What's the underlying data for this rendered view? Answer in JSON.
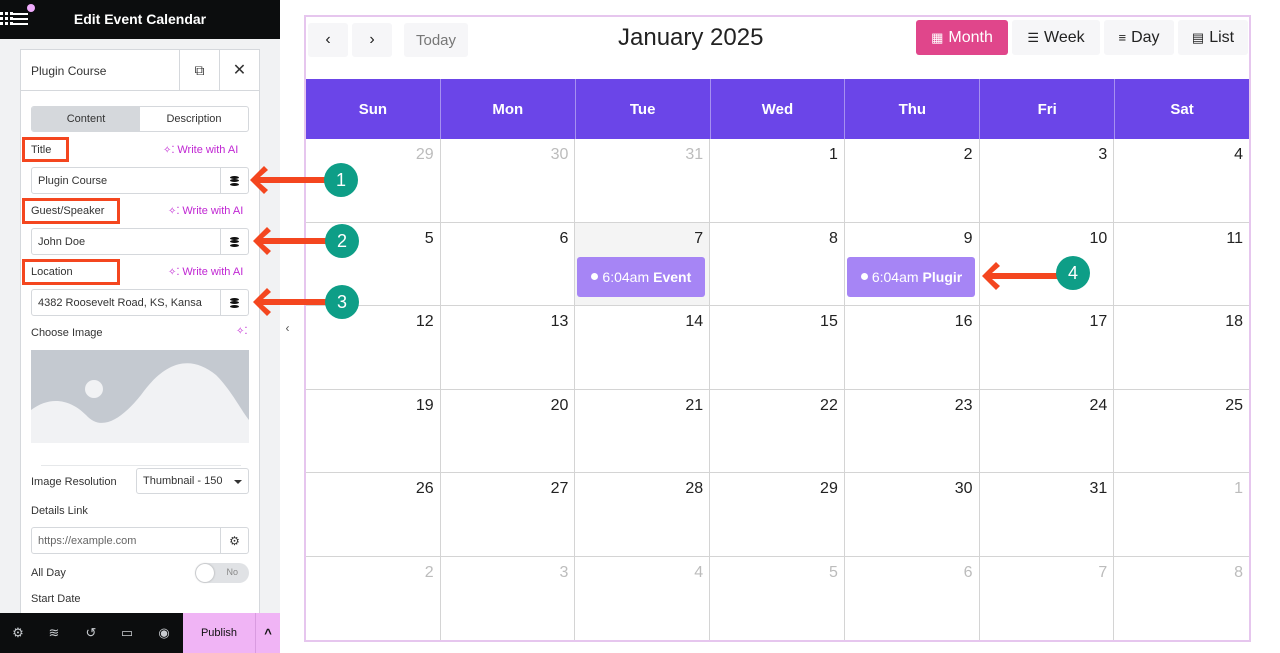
{
  "editor": {
    "title": "Edit Event Calendar",
    "widget_name": "Plugin Course",
    "tabs": [
      {
        "label": "Content",
        "active": true
      },
      {
        "label": "Description",
        "active": false
      }
    ],
    "write_ai_label": "Write with AI",
    "fields": {
      "title": {
        "label": "Title",
        "value": "Plugin Course"
      },
      "guest": {
        "label": "Guest/Speaker",
        "value": "John Doe"
      },
      "location": {
        "label": "Location",
        "value": "4382 Roosevelt Road, KS, Kansa"
      }
    },
    "choose_image_label": "Choose Image",
    "image_resolution": {
      "label": "Image Resolution",
      "value": "Thumbnail - 150"
    },
    "details_link": {
      "label": "Details Link",
      "placeholder": "https://example.com"
    },
    "all_day": {
      "label": "All Day",
      "value": "No"
    },
    "start_date_label": "Start Date",
    "publish_label": "Publish",
    "bottom_icons": [
      "gear-icon",
      "layers-icon",
      "history-icon",
      "responsive-icon",
      "eye-icon"
    ]
  },
  "calendar": {
    "title": "January 2025",
    "today_label": "Today",
    "prev_icon": "‹",
    "next_icon": "›",
    "views": [
      {
        "label": "Month",
        "icon": "grid-icon",
        "active": true
      },
      {
        "label": "Week",
        "icon": "list-icon",
        "active": false
      },
      {
        "label": "Day",
        "icon": "bars-icon",
        "active": false
      },
      {
        "label": "List",
        "icon": "list-block-icon",
        "active": false
      }
    ],
    "weekdays": [
      "Sun",
      "Mon",
      "Tue",
      "Wed",
      "Thu",
      "Fri",
      "Sat"
    ],
    "weeks": [
      [
        {
          "d": "29",
          "o": true
        },
        {
          "d": "30",
          "o": true
        },
        {
          "d": "31",
          "o": true
        },
        {
          "d": "1"
        },
        {
          "d": "2"
        },
        {
          "d": "3"
        },
        {
          "d": "4"
        }
      ],
      [
        {
          "d": "5"
        },
        {
          "d": "6"
        },
        {
          "d": "7",
          "today": true
        },
        {
          "d": "8"
        },
        {
          "d": "9"
        },
        {
          "d": "10"
        },
        {
          "d": "11"
        }
      ],
      [
        {
          "d": "12"
        },
        {
          "d": "13"
        },
        {
          "d": "14"
        },
        {
          "d": "15"
        },
        {
          "d": "16"
        },
        {
          "d": "17"
        },
        {
          "d": "18"
        }
      ],
      [
        {
          "d": "19"
        },
        {
          "d": "20"
        },
        {
          "d": "21"
        },
        {
          "d": "22"
        },
        {
          "d": "23"
        },
        {
          "d": "24"
        },
        {
          "d": "25"
        }
      ],
      [
        {
          "d": "26"
        },
        {
          "d": "27"
        },
        {
          "d": "28"
        },
        {
          "d": "29"
        },
        {
          "d": "30"
        },
        {
          "d": "31"
        },
        {
          "d": "1",
          "o": true
        }
      ],
      [
        {
          "d": "2",
          "o": true
        },
        {
          "d": "3",
          "o": true
        },
        {
          "d": "4",
          "o": true
        },
        {
          "d": "5",
          "o": true
        },
        {
          "d": "6",
          "o": true
        },
        {
          "d": "7",
          "o": true
        },
        {
          "d": "8",
          "o": true
        }
      ]
    ],
    "events": [
      {
        "week": 1,
        "day": 2,
        "time": "6:04am",
        "title": "Event"
      },
      {
        "week": 1,
        "day": 4,
        "time": "6:04am",
        "title": "Plugir"
      }
    ]
  },
  "annotations": [
    {
      "number": "1",
      "target": "title-field"
    },
    {
      "number": "2",
      "target": "guest-field"
    },
    {
      "number": "3",
      "target": "location-field"
    },
    {
      "number": "4",
      "target": "event-jan-9"
    }
  ],
  "colors": {
    "accent_purple": "#6b45e8",
    "event_purple": "#a685f5",
    "active_view_pink": "#e0468b",
    "ai_magenta": "#c026d3",
    "annotation_red": "#f4461f",
    "annotation_teal": "#0e9e87",
    "publish_pink": "#f0b4f5"
  }
}
